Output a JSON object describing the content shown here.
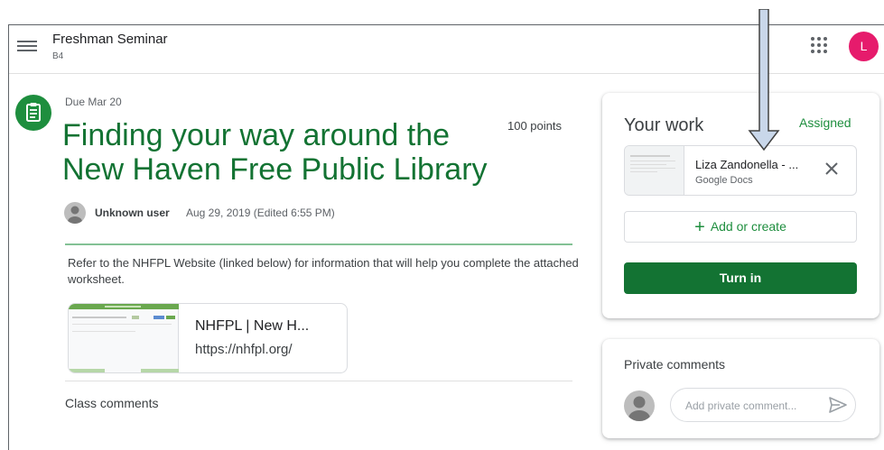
{
  "header": {
    "class_title": "Freshman Seminar",
    "class_section": "B4",
    "avatar_letter": "L"
  },
  "assignment": {
    "due": "Due Mar 20",
    "points": "100 points",
    "title_line1": "Finding your way around the",
    "title_line2": "New Haven Free Public Library",
    "author": "Unknown user",
    "date": "Aug 29, 2019 (Edited 6:55 PM)",
    "description": "Refer to the NHFPL Website (linked below) for information that will help you complete the attached worksheet.",
    "attachment": {
      "title": "NHFPL | New H...",
      "url": "https://nhfpl.org/"
    },
    "class_comments_label": "Class comments"
  },
  "your_work": {
    "title": "Your work",
    "status": "Assigned",
    "doc_name": "Liza Zandonella - ...",
    "doc_type": "Google Docs",
    "add_label": "Add or create",
    "turn_in_label": "Turn in"
  },
  "private_comments": {
    "title": "Private comments",
    "placeholder": "Add private comment..."
  },
  "colors": {
    "accent": "#137333",
    "avatar": "#e61b6c"
  },
  "icons": [
    "menu-icon",
    "apps-icon",
    "assignment-icon",
    "close-icon",
    "plus-icon",
    "send-icon",
    "arrow-down-annotation"
  ]
}
